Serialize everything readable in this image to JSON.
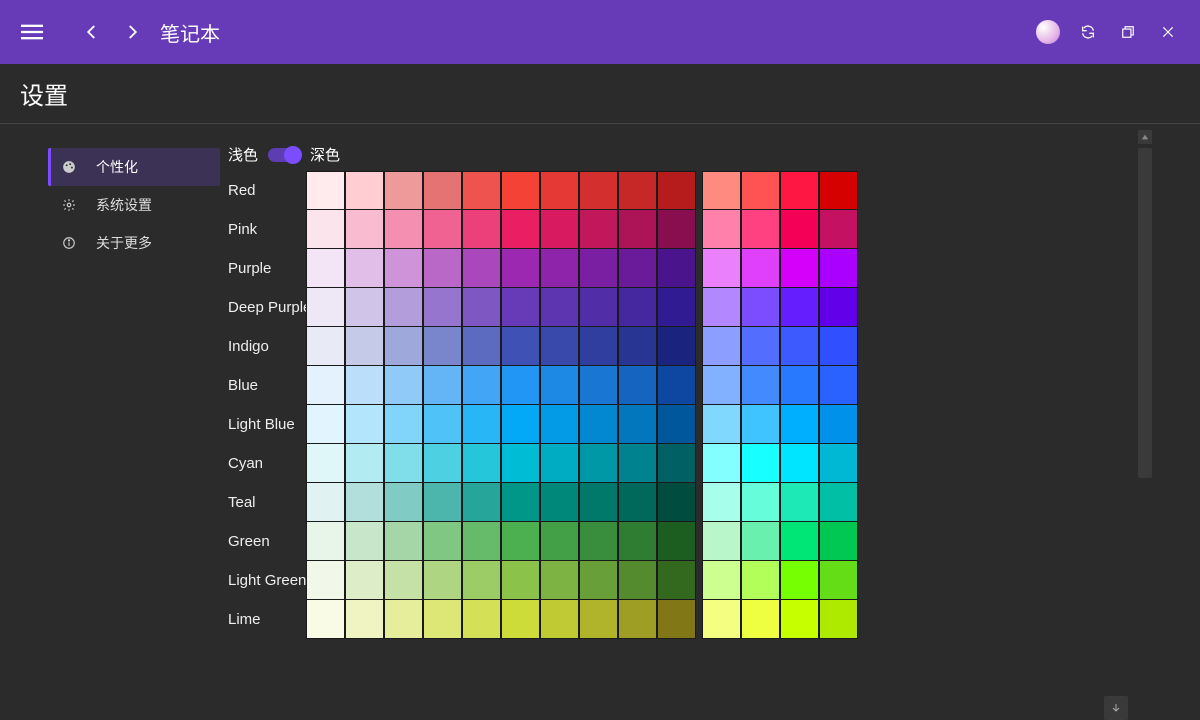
{
  "appbar": {
    "title": "笔记本"
  },
  "page_title": "设置",
  "sidebar": {
    "items": [
      {
        "label": "个性化",
        "icon": "palette-icon",
        "active": true
      },
      {
        "label": "系统设置",
        "icon": "gear-icon",
        "active": false
      },
      {
        "label": "关于更多",
        "icon": "info-icon",
        "active": false
      }
    ]
  },
  "theme_toggle": {
    "light_label": "浅色",
    "dark_label": "深色",
    "value": "dark"
  },
  "palette_rows": [
    {
      "label": "Red",
      "swatches_a": [
        "#FFEBEE",
        "#FFCDD2",
        "#EF9A9A",
        "#E57373",
        "#EF5350",
        "#F44336",
        "#E53935",
        "#D32F2F",
        "#C62828",
        "#B71C1C"
      ],
      "swatches_b": [
        "#FF8A80",
        "#FF5252",
        "#FF1744",
        "#D50000"
      ]
    },
    {
      "label": "Pink",
      "swatches_a": [
        "#FCE4EC",
        "#F8BBD0",
        "#F48FB1",
        "#F06292",
        "#EC407A",
        "#E91E63",
        "#D81B60",
        "#C2185B",
        "#AD1457",
        "#880E4F"
      ],
      "swatches_b": [
        "#FF80AB",
        "#FF4081",
        "#F50057",
        "#C51162"
      ]
    },
    {
      "label": "Purple",
      "swatches_a": [
        "#F3E5F5",
        "#E1BEE7",
        "#CE93D8",
        "#BA68C8",
        "#AB47BC",
        "#9C27B0",
        "#8E24AA",
        "#7B1FA2",
        "#6A1B9A",
        "#4A148C"
      ],
      "swatches_b": [
        "#EA80FC",
        "#E040FB",
        "#D500F9",
        "#AA00FF"
      ]
    },
    {
      "label": "Deep Purple",
      "swatches_a": [
        "#EDE7F6",
        "#D1C4E9",
        "#B39DDB",
        "#9575CD",
        "#7E57C2",
        "#673AB7",
        "#5E35B1",
        "#512DA8",
        "#4527A0",
        "#311B92"
      ],
      "swatches_b": [
        "#B388FF",
        "#7C4DFF",
        "#651FFF",
        "#6200EA"
      ]
    },
    {
      "label": "Indigo",
      "swatches_a": [
        "#E8EAF6",
        "#C5CAE9",
        "#9FA8DA",
        "#7986CB",
        "#5C6BC0",
        "#3F51B5",
        "#3949AB",
        "#303F9F",
        "#283593",
        "#1A237E"
      ],
      "swatches_b": [
        "#8C9EFF",
        "#536DFE",
        "#3D5AFE",
        "#304FFE"
      ]
    },
    {
      "label": "Blue",
      "swatches_a": [
        "#E3F2FD",
        "#BBDEFB",
        "#90CAF9",
        "#64B5F6",
        "#42A5F5",
        "#2196F3",
        "#1E88E5",
        "#1976D2",
        "#1565C0",
        "#0D47A1"
      ],
      "swatches_b": [
        "#82B1FF",
        "#448AFF",
        "#2979FF",
        "#2962FF"
      ]
    },
    {
      "label": "Light Blue",
      "swatches_a": [
        "#E1F5FE",
        "#B3E5FC",
        "#81D4FA",
        "#4FC3F7",
        "#29B6F6",
        "#03A9F4",
        "#039BE5",
        "#0288D1",
        "#0277BD",
        "#01579B"
      ],
      "swatches_b": [
        "#80D8FF",
        "#40C4FF",
        "#00B0FF",
        "#0091EA"
      ]
    },
    {
      "label": "Cyan",
      "swatches_a": [
        "#E0F7FA",
        "#B2EBF2",
        "#80DEEA",
        "#4DD0E1",
        "#26C6DA",
        "#00BCD4",
        "#00ACC1",
        "#0097A7",
        "#00838F",
        "#006064"
      ],
      "swatches_b": [
        "#84FFFF",
        "#18FFFF",
        "#00E5FF",
        "#00B8D4"
      ]
    },
    {
      "label": "Teal",
      "swatches_a": [
        "#E0F2F1",
        "#B2DFDB",
        "#80CBC4",
        "#4DB6AC",
        "#26A69A",
        "#009688",
        "#00897B",
        "#00796B",
        "#00695C",
        "#004D40"
      ],
      "swatches_b": [
        "#A7FFEB",
        "#64FFDA",
        "#1DE9B6",
        "#00BFA5"
      ]
    },
    {
      "label": "Green",
      "swatches_a": [
        "#E8F5E9",
        "#C8E6C9",
        "#A5D6A7",
        "#81C784",
        "#66BB6A",
        "#4CAF50",
        "#43A047",
        "#388E3C",
        "#2E7D32",
        "#1B5E20"
      ],
      "swatches_b": [
        "#B9F6CA",
        "#69F0AE",
        "#00E676",
        "#00C853"
      ]
    },
    {
      "label": "Light Green",
      "swatches_a": [
        "#F1F8E9",
        "#DCEDC8",
        "#C5E1A5",
        "#AED581",
        "#9CCC65",
        "#8BC34A",
        "#7CB342",
        "#689F38",
        "#558B2F",
        "#33691E"
      ],
      "swatches_b": [
        "#CCFF90",
        "#B2FF59",
        "#76FF03",
        "#64DD17"
      ]
    },
    {
      "label": "Lime",
      "swatches_a": [
        "#F9FBE7",
        "#F0F4C3",
        "#E6EE9C",
        "#DCE775",
        "#D4E157",
        "#CDDC39",
        "#C0CA33",
        "#AFB42B",
        "#9E9D24",
        "#827717"
      ],
      "swatches_b": [
        "#F4FF81",
        "#EEFF41",
        "#C6FF00",
        "#AEEA00"
      ]
    }
  ]
}
